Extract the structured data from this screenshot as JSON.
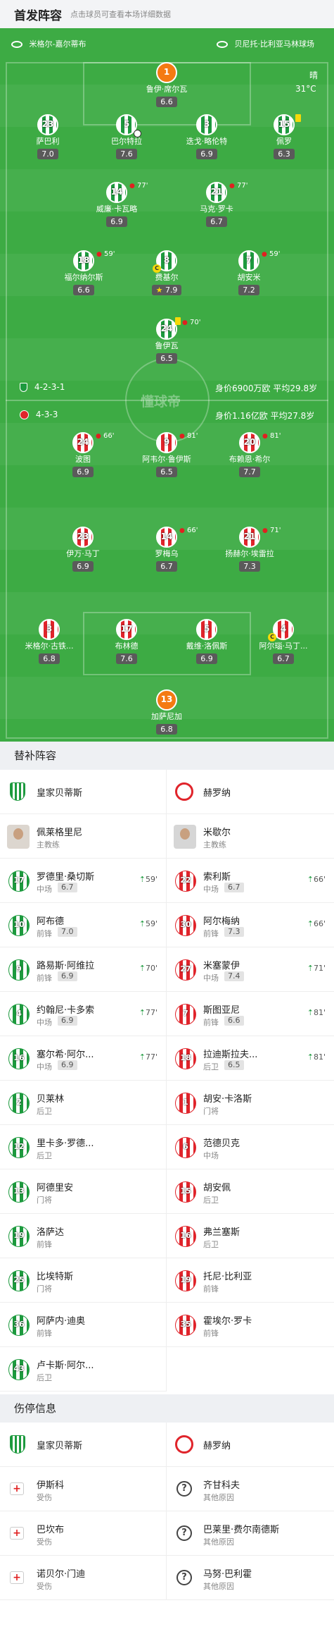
{
  "header": {
    "title": "首发阵容",
    "subtitle": "点击球员可查看本场详细数据"
  },
  "match": {
    "home_team": "米格尔-嘉尔蒂布",
    "venue": "贝尼托·比利亚马林球场",
    "weather": "晴",
    "temperature": "31°C"
  },
  "home_lineup": {
    "formation": "4-2-3-1",
    "value": "身价6900万欧",
    "avg_age": "平均29.8岁"
  },
  "away_lineup": {
    "formation": "4-3-3",
    "value": "身价1.16亿欧",
    "avg_age": "平均27.8岁"
  },
  "watermark": "懂球帝",
  "home_players": [
    {
      "num": "1",
      "name": "鲁伊·席尔瓦",
      "rating": "6.6"
    },
    {
      "num": "23",
      "name": "萨巴利",
      "rating": "7.0"
    },
    {
      "num": "5",
      "name": "巴尔特拉",
      "rating": "7.6"
    },
    {
      "num": "3",
      "name": "迭戈·略伦特",
      "rating": "6.9"
    },
    {
      "num": "15",
      "name": "佩罗",
      "rating": "6.3"
    },
    {
      "num": "14",
      "name": "威廉·卡瓦略",
      "rating": "6.9",
      "sub": "77'"
    },
    {
      "num": "21",
      "name": "马克·罗卡",
      "rating": "6.7",
      "sub": "77'"
    },
    {
      "num": "18",
      "name": "福尔纳尔斯",
      "rating": "6.6",
      "sub": "59'"
    },
    {
      "num": "8",
      "name": "费基尔",
      "rating": "7.9"
    },
    {
      "num": "7",
      "name": "胡安米",
      "rating": "7.2",
      "sub": "59'"
    },
    {
      "num": "24",
      "name": "鲁伊瓦",
      "rating": "6.5",
      "sub": "70'"
    }
  ],
  "away_players": [
    {
      "num": "24",
      "name": "波图",
      "rating": "6.9",
      "sub": "66'"
    },
    {
      "num": "9",
      "name": "阿韦尔·鲁伊斯",
      "rating": "6.5",
      "sub": "81'"
    },
    {
      "num": "20",
      "name": "布赖恩·希尔",
      "rating": "7.7",
      "sub": "81'"
    },
    {
      "num": "23",
      "name": "伊万·马丁",
      "rating": "6.9"
    },
    {
      "num": "14",
      "name": "罗梅乌",
      "rating": "6.7",
      "sub": "66'"
    },
    {
      "num": "21",
      "name": "扬赫尔·埃雷拉",
      "rating": "7.3",
      "sub": "71'"
    },
    {
      "num": "3",
      "name": "米格尔·古铁...",
      "rating": "6.8"
    },
    {
      "num": "17",
      "name": "布林德",
      "rating": "7.6"
    },
    {
      "num": "5",
      "name": "戴维·洛佩斯",
      "rating": "6.9"
    },
    {
      "num": "4",
      "name": "阿尔瑙·马丁...",
      "rating": "6.7"
    },
    {
      "num": "13",
      "name": "加萨尼加",
      "rating": "6.8"
    }
  ],
  "subs_title": "替补阵容",
  "subs": {
    "home_team": "皇家贝蒂斯",
    "away_team": "赫罗纳",
    "home_coach": {
      "name": "佩莱格里尼",
      "role": "主教练"
    },
    "away_coach": {
      "name": "米歇尔",
      "role": "主教练"
    },
    "home": [
      {
        "num": "17",
        "name": "罗德里·桑切斯",
        "pos": "中场",
        "rating": "6.7",
        "time": "59'"
      },
      {
        "num": "10",
        "name": "阿布德",
        "pos": "前锋",
        "rating": "7.0",
        "time": "59'"
      },
      {
        "num": "9",
        "name": "路易斯·阿维拉",
        "pos": "前锋",
        "rating": "6.9",
        "time": "70'"
      },
      {
        "num": "4",
        "name": "约翰尼·卡多索",
        "pos": "中场",
        "rating": "6.9",
        "time": "77'"
      },
      {
        "num": "16",
        "name": "塞尔希·阿尔...",
        "pos": "中场",
        "rating": "6.9",
        "time": "77'"
      },
      {
        "num": "2",
        "name": "贝莱林",
        "pos": "后卫"
      },
      {
        "num": "12",
        "name": "里卡多·罗德...",
        "pos": "后卫"
      },
      {
        "num": "13",
        "name": "阿德里安",
        "pos": "门将"
      },
      {
        "num": "19",
        "name": "洛萨达",
        "pos": "前锋"
      },
      {
        "num": "25",
        "name": "比埃特斯",
        "pos": "门将"
      },
      {
        "num": "36",
        "name": "阿萨内·迪奥",
        "pos": "前锋"
      },
      {
        "num": "43",
        "name": "卢卡斯·阿尔...",
        "pos": "后卫"
      }
    ],
    "away": [
      {
        "num": "22",
        "name": "索利斯",
        "pos": "中场",
        "rating": "6.7",
        "time": "66'"
      },
      {
        "num": "30",
        "name": "阿尔梅纳",
        "pos": "前锋",
        "rating": "7.3",
        "time": "66'"
      },
      {
        "num": "27",
        "name": "米塞蒙伊",
        "pos": "中场",
        "rating": "7.4",
        "time": "71'"
      },
      {
        "num": "7",
        "name": "斯图亚尼",
        "pos": "前锋",
        "rating": "6.6",
        "time": "81'"
      },
      {
        "num": "18",
        "name": "拉迪斯拉夫...",
        "pos": "后卫",
        "rating": "6.5",
        "time": "81'"
      },
      {
        "num": "1",
        "name": "胡安·卡洛斯",
        "pos": "门将"
      },
      {
        "num": "6",
        "name": "范德贝克",
        "pos": "中场"
      },
      {
        "num": "15",
        "name": "胡安佩",
        "pos": "后卫"
      },
      {
        "num": "16",
        "name": "弗兰塞斯",
        "pos": "后卫"
      },
      {
        "num": "19",
        "name": "托尼·比利亚",
        "pos": "前锋"
      },
      {
        "num": "35",
        "name": "霍埃尔·罗卡",
        "pos": "前锋"
      }
    ]
  },
  "injury_title": "伤停信息",
  "injuries": {
    "home_team": "皇家贝蒂斯",
    "away_team": "赫罗纳",
    "home": [
      {
        "name": "伊斯科",
        "reason": "受伤"
      },
      {
        "name": "巴坎布",
        "reason": "受伤"
      },
      {
        "name": "诺贝尔·门迪",
        "reason": "受伤"
      }
    ],
    "away": [
      {
        "name": "齐甘科夫",
        "reason": "其他原因"
      },
      {
        "name": "巴莱里·费尔南德斯",
        "reason": "其他原因"
      },
      {
        "name": "马努·巴利霍",
        "reason": "其他原因"
      }
    ]
  },
  "colors": {
    "pitch": "#3dab44",
    "home_kit": "#1d9a3e",
    "away_kit": "#e0242b",
    "goalkeeper": "#f47a12"
  }
}
